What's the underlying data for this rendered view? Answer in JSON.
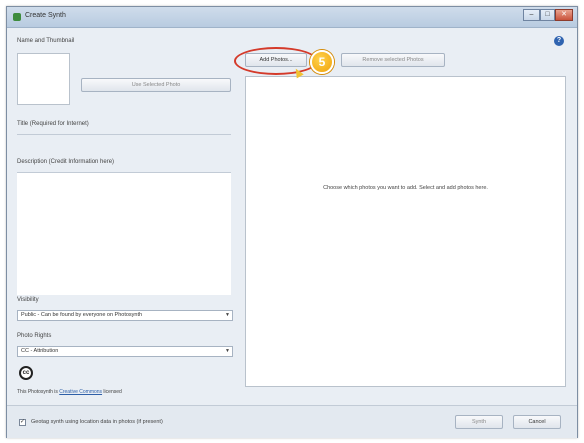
{
  "window": {
    "title": "Create Synth",
    "min_glyph": "–",
    "max_glyph": "□",
    "close_glyph": "✕"
  },
  "help": {
    "glyph": "?"
  },
  "left": {
    "name_thumb_label": "Name and Thumbnail",
    "use_selected_button": "Use Selected Photo",
    "title_label": "Title (Required for Internet)",
    "description_label": "Description (Credit Information here)",
    "visibility_label": "Visibility",
    "visibility_value": "Public - Can be found by everyone on Photosynth",
    "photo_rights_label": "Photo Rights",
    "photo_rights_value": "CC - Attribution",
    "cc_glyph": "cc",
    "license_prefix": "This Photosynth is ",
    "license_link": "Creative Commons",
    "license_suffix": " licensed"
  },
  "right": {
    "add_photos_button": "Add Photos...",
    "remove_photos_button": "Remove selected Photos",
    "empty_message": "Choose which photos you want to add. Select and add photos here.",
    "step_number": "5"
  },
  "bottom": {
    "checkbox_glyph": "✓",
    "checkbox_label": "Geotag synth using location data in photos (if present)",
    "synth_button": "Synth",
    "cancel_button": "Cancel"
  }
}
